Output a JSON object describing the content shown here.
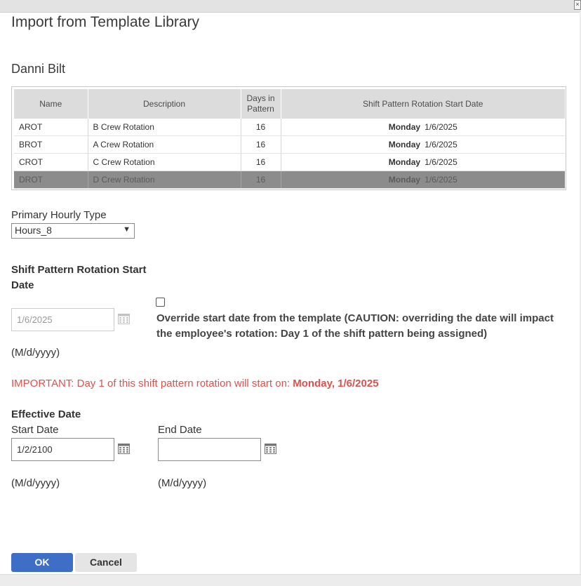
{
  "window": {
    "close_glyph": "×"
  },
  "dialog": {
    "title": "Import from Template Library",
    "employee_name": "Danni Bilt"
  },
  "table": {
    "headers": {
      "name": "Name",
      "description": "Description",
      "days_in_pattern": "Days in Pattern",
      "start_date": "Shift Pattern Rotation Start Date"
    },
    "rows": [
      {
        "name": "AROT",
        "description": "B Crew Rotation",
        "days": "16",
        "day": "Monday",
        "date": "1/6/2025",
        "selected": false
      },
      {
        "name": "BROT",
        "description": "A Crew Rotation",
        "days": "16",
        "day": "Monday",
        "date": "1/6/2025",
        "selected": false
      },
      {
        "name": "CROT",
        "description": "C Crew Rotation",
        "days": "16",
        "day": "Monday",
        "date": "1/6/2025",
        "selected": false
      },
      {
        "name": "DROT",
        "description": "D Crew Rotation",
        "days": "16",
        "day": "Monday",
        "date": "1/6/2025",
        "selected": true
      }
    ]
  },
  "hourly_type": {
    "label": "Primary Hourly Type",
    "value": "Hours_8"
  },
  "rotation_start": {
    "label_line1": "Shift Pattern Rotation Start",
    "label_line2": "Date",
    "value": "1/6/2025",
    "format": "(M/d/yyyy)",
    "override_label": "Override start date from the template (CAUTION: overriding the date will impact the employee's rotation: Day 1 of the shift pattern being assigned)",
    "override_checked": false
  },
  "important": {
    "prefix": "IMPORTANT: Day 1 of this shift pattern rotation will start on: ",
    "date_text": "Monday, 1/6/2025"
  },
  "effective": {
    "label": "Effective Date",
    "start_label": "Start Date",
    "start_value": "1/2/2100",
    "end_label": "End Date",
    "end_value": "",
    "format": "(M/d/yyyy)"
  },
  "buttons": {
    "ok": "OK",
    "cancel": "Cancel"
  },
  "colors": {
    "primary": "#3f6ec7",
    "warning": "#d9534f",
    "selected_row": "#8c8c8c"
  },
  "icons": {
    "calendar": "calendar-icon",
    "dropdown": "chevron-down-icon",
    "close": "close-icon"
  }
}
